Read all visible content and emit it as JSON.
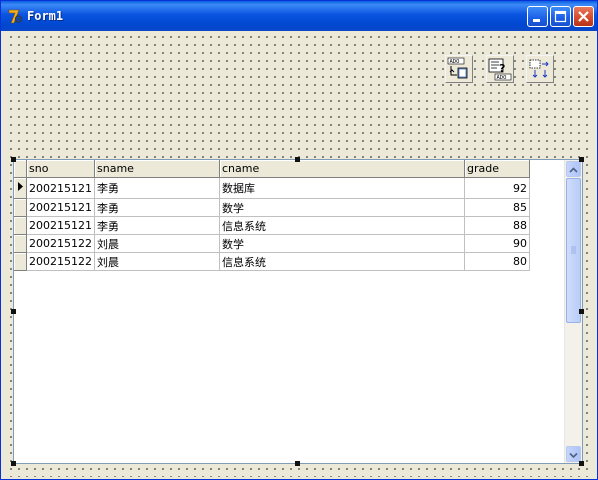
{
  "window": {
    "title": "Form1"
  },
  "colors": {
    "titlebar": "#0a54e0",
    "close": "#d6482a",
    "form_bg": "#ece9d8"
  },
  "components": [
    {
      "name": "ado-connection-icon",
      "caption": "ADO"
    },
    {
      "name": "ado-query-icon",
      "caption": "ADO"
    },
    {
      "name": "datasource-icon",
      "caption": ""
    }
  ],
  "grid": {
    "columns": [
      "sno",
      "sname",
      "cname",
      "grade"
    ],
    "rows": [
      [
        "200215121",
        "李勇",
        "数据库",
        "92"
      ],
      [
        "200215121",
        "李勇",
        "数学",
        "85"
      ],
      [
        "200215121",
        "李勇",
        "信息系统",
        "88"
      ],
      [
        "200215122",
        "刘晨",
        "数学",
        "90"
      ],
      [
        "200215122",
        "刘晨",
        "信息系统",
        "80"
      ]
    ]
  }
}
